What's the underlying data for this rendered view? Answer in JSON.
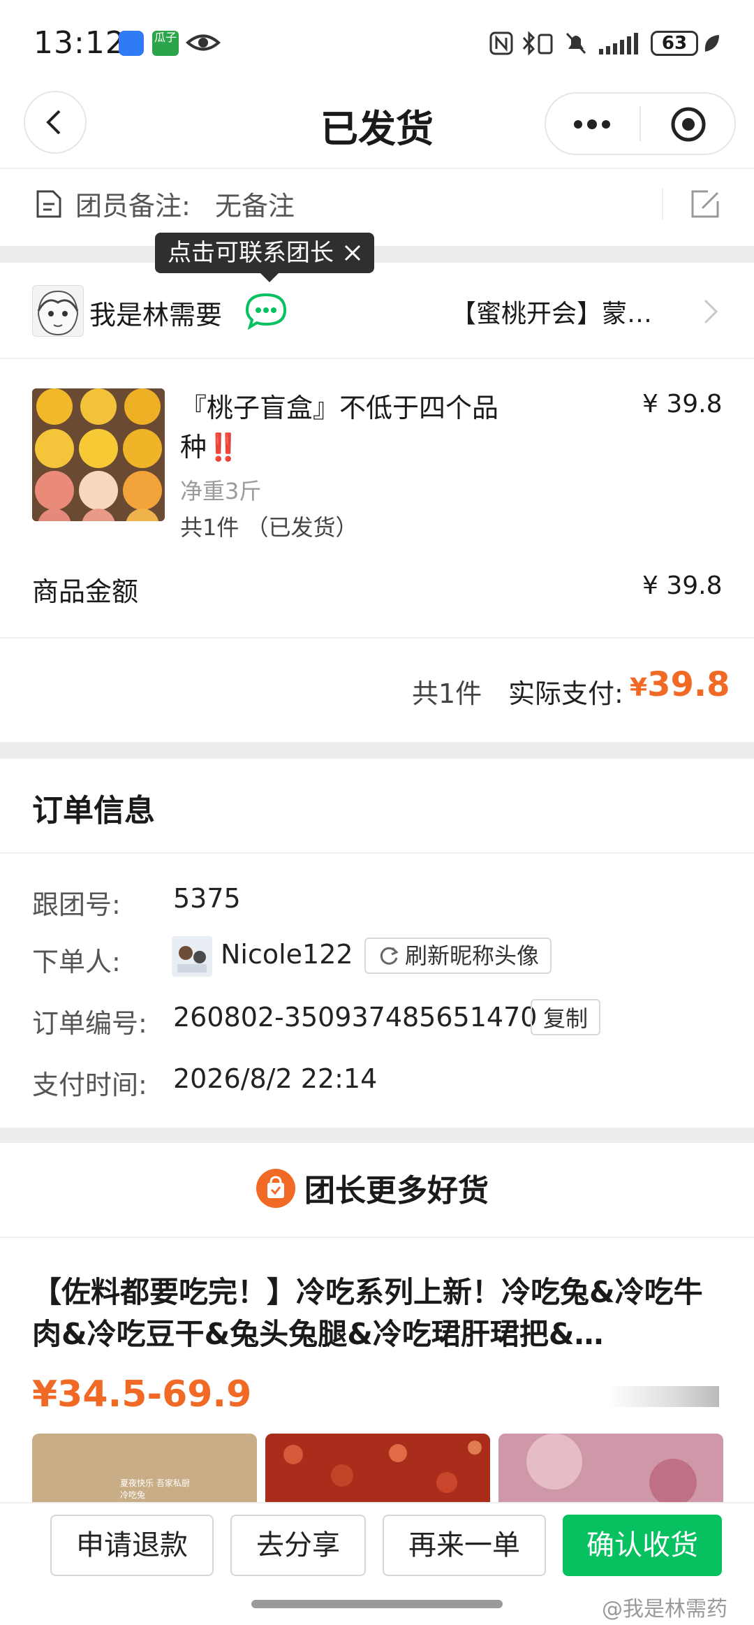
{
  "status_bar": {
    "time": "13:12",
    "battery": "63",
    "app_badge_label": "瓜子"
  },
  "header": {
    "title": "已发货",
    "back_icon": "chevron-left-icon",
    "more_icon": "more-dots-icon",
    "close_icon": "record-circle-icon"
  },
  "remark": {
    "label": "团员备注:",
    "value": "无备注"
  },
  "tooltip": {
    "text": "点击可联系团长"
  },
  "leader": {
    "name": "我是林需要",
    "shop": "【蜜桃开会】蒙…"
  },
  "product": {
    "title": "『桃子盲盒』不低于四个品种‼️",
    "price": "¥ 39.8",
    "weight": "净重3斤",
    "quantity": "共1件 （已发货）"
  },
  "amount": {
    "label": "商品金额",
    "value": "¥ 39.8"
  },
  "payment": {
    "count": "共1件",
    "label": "实际支付:",
    "currency": "¥",
    "value": "39.8"
  },
  "order_info": {
    "title": "订单信息",
    "group_no_label": "跟团号:",
    "group_no_value": "5375",
    "orderer_label": "下单人:",
    "orderer_value": "Nicole122",
    "refresh_label": "刷新昵称头像",
    "order_no_label": "订单编号:",
    "order_no_value": "260802-350937485651470",
    "copy_label": "复制",
    "pay_time_label": "支付时间:",
    "pay_time_value": "2026/8/2 22:14"
  },
  "more_goods": {
    "title": "团长更多好货",
    "description": "【佐料都要吃完！】冷吃系列上新！冷吃兔&冷吃牛肉&冷吃豆干&兔头兔腿&冷吃珺肝珺把&…",
    "price": "¥34.5-69.9",
    "image_caption": "夏夜快乐 吾家私厨冷吃兔"
  },
  "bottom_bar": {
    "refund": "申请退款",
    "share": "去分享",
    "reorder": "再来一单",
    "confirm": "确认收货"
  },
  "watermark": "@我是林需药",
  "colors": {
    "accent_orange": "#f06a25",
    "wechat_green": "#07c160"
  }
}
